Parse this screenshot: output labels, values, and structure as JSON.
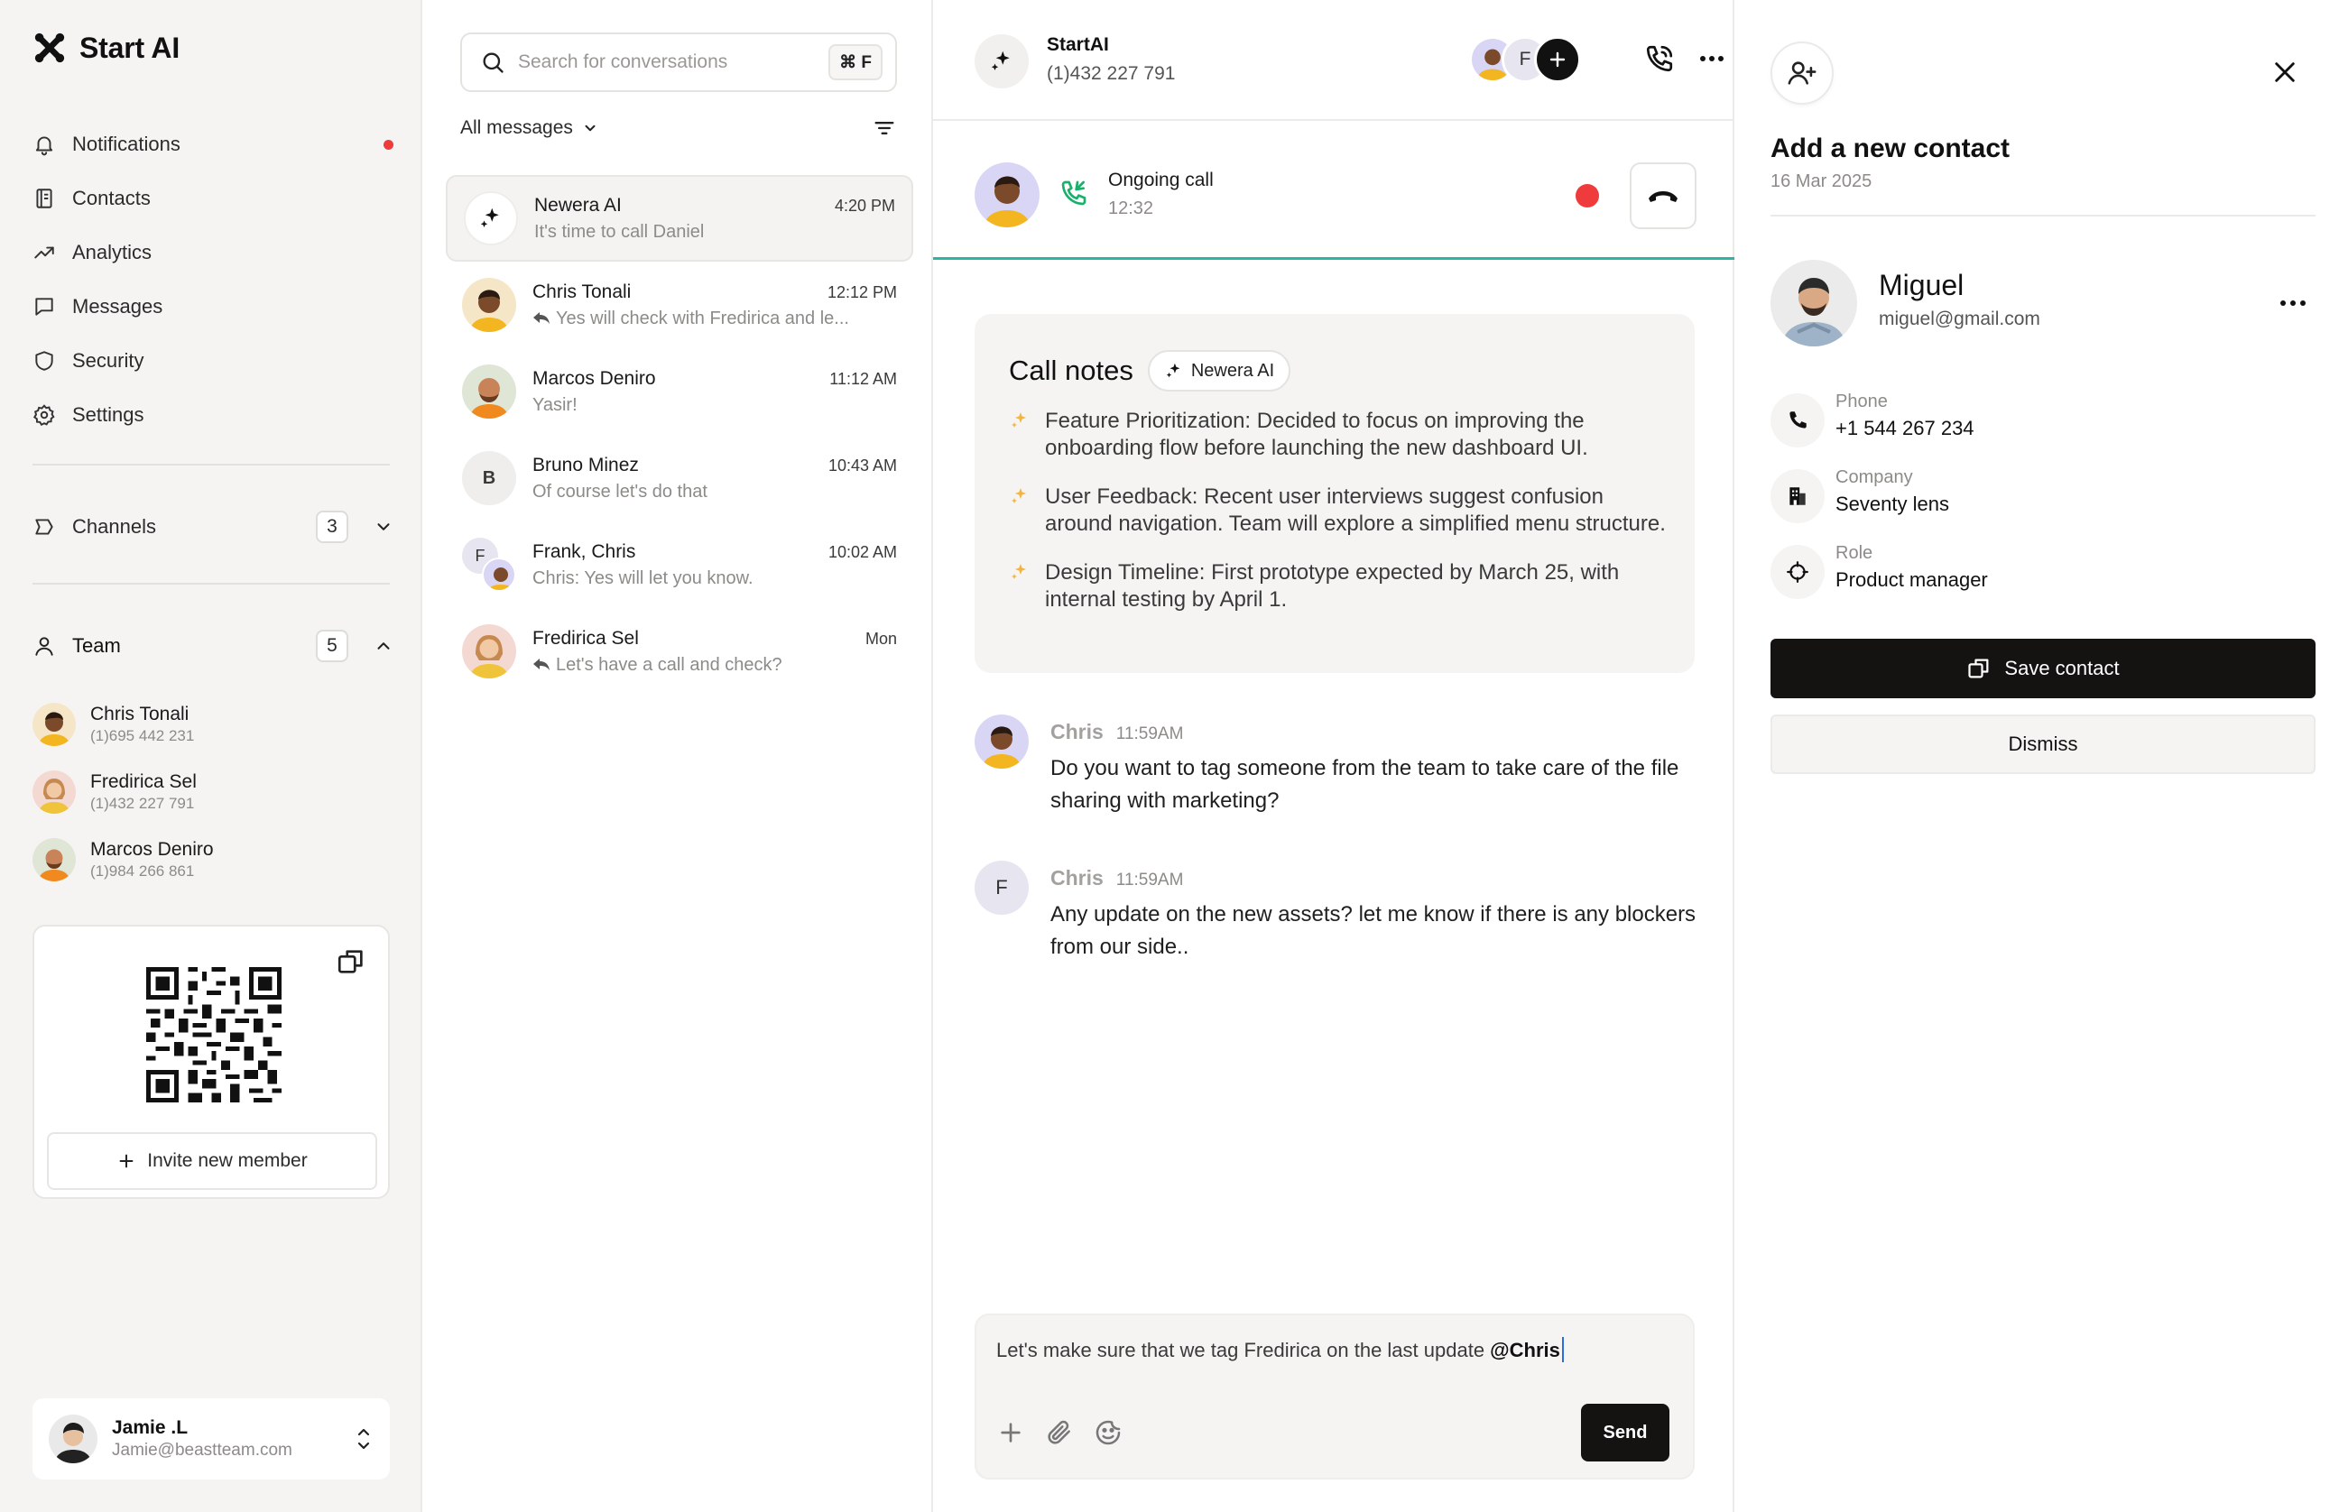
{
  "app": {
    "name": "Start AI"
  },
  "sidebar": {
    "nav": [
      {
        "label": "Notifications",
        "icon": "bell-icon",
        "has_dot": true
      },
      {
        "label": "Contacts",
        "icon": "contacts-icon"
      },
      {
        "label": "Analytics",
        "icon": "trend-icon"
      },
      {
        "label": "Messages",
        "icon": "message-icon"
      },
      {
        "label": "Security",
        "icon": "shield-icon"
      },
      {
        "label": "Settings",
        "icon": "gear-icon"
      }
    ],
    "channels": {
      "label": "Channels",
      "count": "3",
      "expanded": false
    },
    "team": {
      "label": "Team",
      "count": "5",
      "expanded": true,
      "members": [
        {
          "name": "Chris Tonali",
          "phone": "(1)695 442 231"
        },
        {
          "name": "Fredirica Sel",
          "phone": "(1)432 227 791"
        },
        {
          "name": "Marcos Deniro",
          "phone": "(1)984 266 861"
        }
      ]
    },
    "invite": {
      "label": "Invite new member"
    },
    "user": {
      "name": "Jamie .L",
      "email": "Jamie@beastteam.com"
    }
  },
  "conversations": {
    "search": {
      "placeholder": "Search for conversations",
      "shortcut": "⌘ F"
    },
    "filter": {
      "label": "All messages"
    },
    "items": [
      {
        "name": "Newera AI",
        "time": "4:20 PM",
        "preview": "It's time to call Daniel",
        "active": true,
        "reply": false
      },
      {
        "name": "Chris Tonali",
        "time": "12:12 PM",
        "preview": "Yes will check with Fredirica and le...",
        "reply": true
      },
      {
        "name": "Marcos Deniro",
        "time": "11:12 AM",
        "preview": "Yasir!",
        "reply": false
      },
      {
        "name": "Bruno Minez",
        "time": "10:43 AM",
        "preview": "Of course let's do that",
        "reply": false,
        "initial": "B"
      },
      {
        "name": "Frank, Chris",
        "time": "10:02 AM",
        "preview": "Chris: Yes will let you know.",
        "reply": false,
        "initial": "F"
      },
      {
        "name": "Fredirica Sel",
        "time": "Mon",
        "preview": "Let's have a call and check?",
        "reply": true
      }
    ]
  },
  "chat": {
    "title": "StartAI",
    "phone": "(1)432 227 791",
    "participant_initial": "F",
    "call": {
      "label": "Ongoing call",
      "duration": "12:32"
    },
    "notes": {
      "title": "Call notes",
      "ai_chip": "Newera AI",
      "items": [
        "Feature Prioritization: Decided to focus on improving the onboarding flow before launching the new dashboard UI.",
        "User Feedback: Recent user interviews suggest confusion around navigation. Team will explore a simplified menu structure.",
        "Design Timeline: First prototype expected by March 25, with internal testing by April 1."
      ]
    },
    "messages": [
      {
        "sender": "Chris",
        "time": "11:59AM",
        "text": "Do you want to tag someone from the team to take care of the file sharing with marketing?"
      },
      {
        "sender": "Chris",
        "time": "11:59AM",
        "text": "Any update on the new assets? let me know if there is any blockers from our side..",
        "initial": "F"
      }
    ],
    "composer": {
      "text": "Let's make sure that we tag Fredirica on the last update ",
      "mention": "@Chris",
      "send_label": "Send"
    }
  },
  "contact_panel": {
    "title": "Add a new contact",
    "date": "16 Mar 2025",
    "name": "Miguel",
    "email": "miguel@gmail.com",
    "fields": [
      {
        "label": "Phone",
        "value": "+1 544 267 234",
        "icon": "phone-icon"
      },
      {
        "label": "Company",
        "value": "Seventy lens",
        "icon": "building-icon"
      },
      {
        "label": "Role",
        "value": "Product manager",
        "icon": "target-icon"
      }
    ],
    "save_label": "Save contact",
    "dismiss_label": "Dismiss"
  },
  "colors": {
    "accent_dark": "#151212",
    "record_red": "#ef3b3b",
    "call_green": "#18b06b",
    "call_divider": "#2cb5a0",
    "ai_sparkle": "#f2b640"
  }
}
